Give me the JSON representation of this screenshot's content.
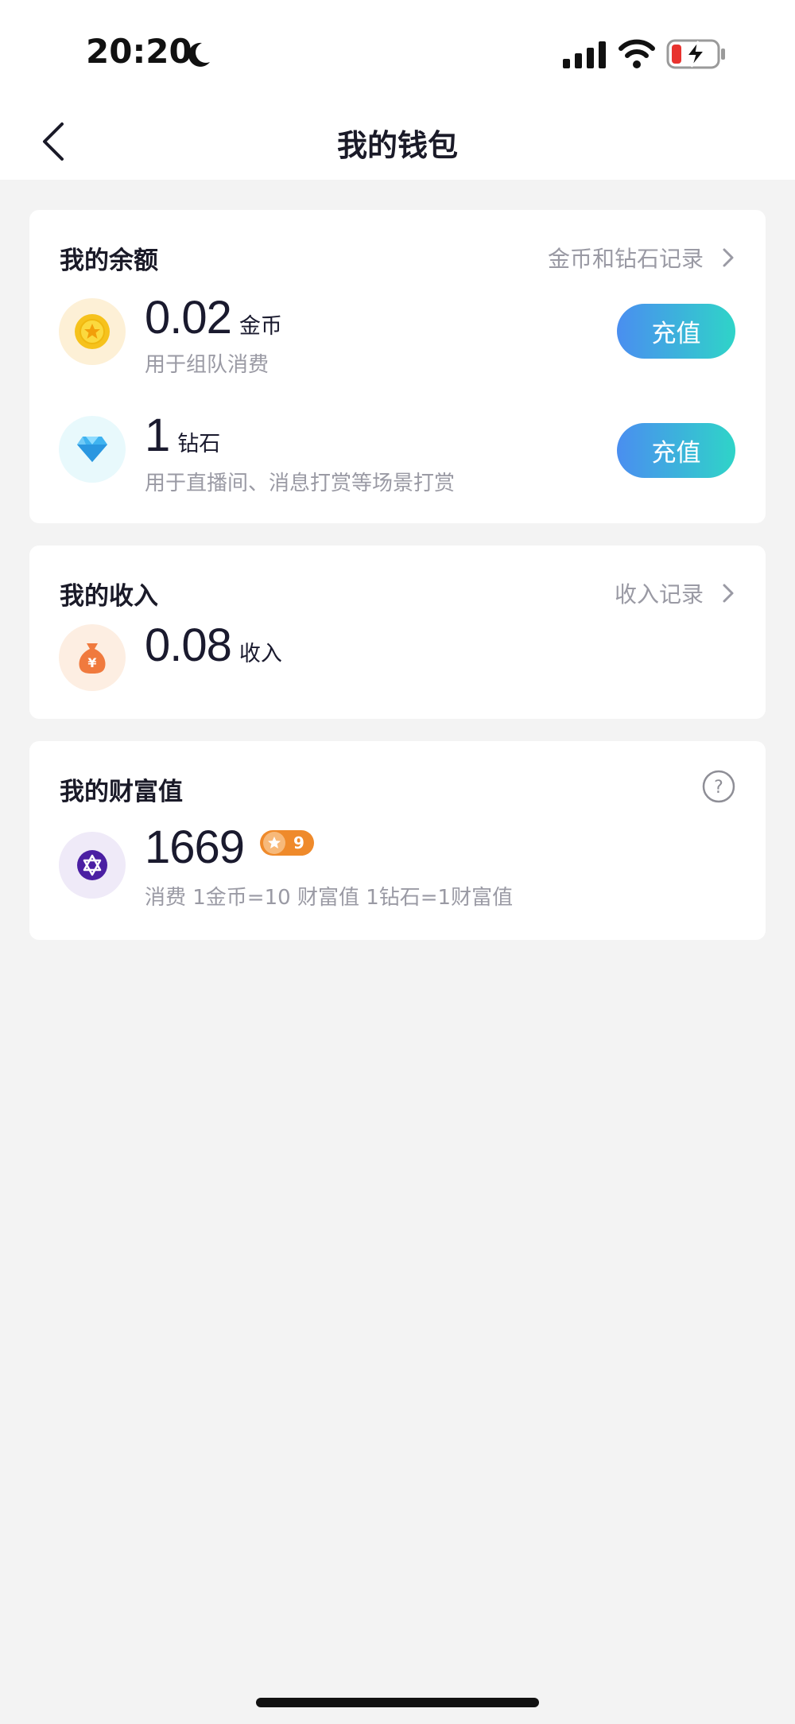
{
  "status_bar": {
    "time": "20:20"
  },
  "nav": {
    "title": "我的钱包"
  },
  "balance": {
    "title": "我的余额",
    "record_link": "金币和钻石记录",
    "coins": {
      "amount": "0.02",
      "unit": "金币",
      "desc": "用于组队消费",
      "button": "充值"
    },
    "diamonds": {
      "amount": "1",
      "unit": "钻石",
      "desc": "用于直播间、消息打赏等场景打赏",
      "button": "充值"
    }
  },
  "income": {
    "title": "我的收入",
    "record_link": "收入记录",
    "amount": "0.08",
    "unit": "收入"
  },
  "wealth": {
    "title": "我的财富值",
    "amount": "1669",
    "level": "9",
    "desc": "消费 1金币=10 财富值 1钻石=1财富值"
  },
  "colors": {
    "accent_gradient_start": "#4a8ef0",
    "accent_gradient_end": "#2fd4c8",
    "badge": "#ef8a2b"
  }
}
